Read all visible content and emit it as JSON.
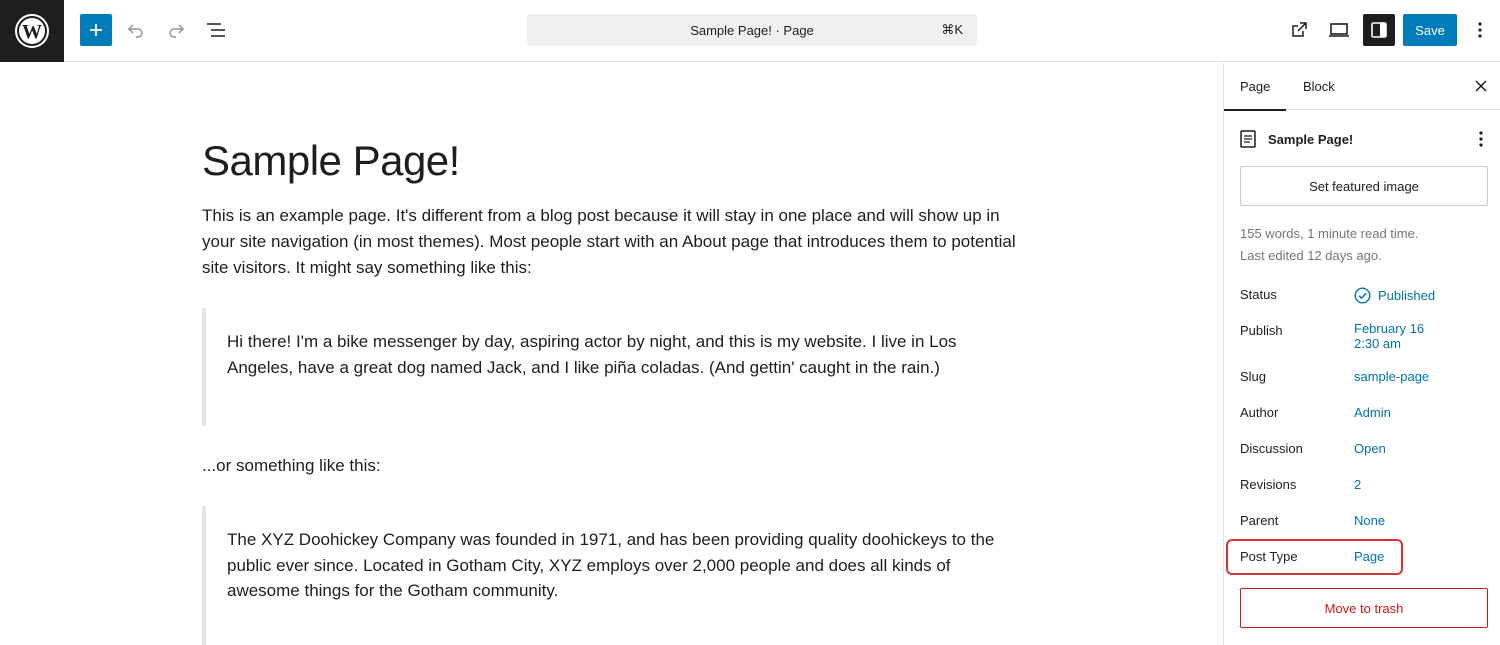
{
  "header": {
    "command_bar": {
      "title": "Sample Page! · Page",
      "shortcut": "⌘K"
    },
    "save_label": "Save"
  },
  "editor": {
    "title": "Sample Page!",
    "intro": "This is an example page. It's different from a blog post because it will stay in one place and will show up in your site navigation (in most themes). Most people start with an About page that introduces them to potential site visitors. It might say something like this:",
    "quote1": "Hi there! I'm a bike messenger by day, aspiring actor by night, and this is my website. I live in Los Angeles, have a great dog named Jack, and I like piña coladas. (And gettin' caught in the rain.)",
    "middle": "...or something like this:",
    "quote2": "The XYZ Doohickey Company was founded in 1971, and has been providing quality doohickeys to the public ever since. Located in Gotham City, XYZ employs over 2,000 people and does all kinds of awesome things for the Gotham community."
  },
  "sidebar": {
    "tabs": [
      "Page",
      "Block"
    ],
    "active_tab": "Page",
    "doc_title": "Sample Page!",
    "featured_button": "Set featured image",
    "meta_line1": "155 words, 1 minute read time.",
    "meta_line2": "Last edited 12 days ago.",
    "fields": {
      "status": {
        "label": "Status",
        "value": "Published"
      },
      "publish": {
        "label": "Publish",
        "value_line1": "February 16",
        "value_line2": "2:30 am"
      },
      "slug": {
        "label": "Slug",
        "value": "sample-page"
      },
      "author": {
        "label": "Author",
        "value": "Admin"
      },
      "discussion": {
        "label": "Discussion",
        "value": "Open"
      },
      "revisions": {
        "label": "Revisions",
        "value": "2"
      },
      "parent": {
        "label": "Parent",
        "value": "None"
      },
      "post_type": {
        "label": "Post Type",
        "value": "Page"
      }
    },
    "trash_button": "Move to trash"
  },
  "colors": {
    "accent": "#007cba",
    "link": "#0073aa",
    "dark": "#1e1e1e",
    "danger": "#cc1818",
    "highlight": "#d63638"
  }
}
